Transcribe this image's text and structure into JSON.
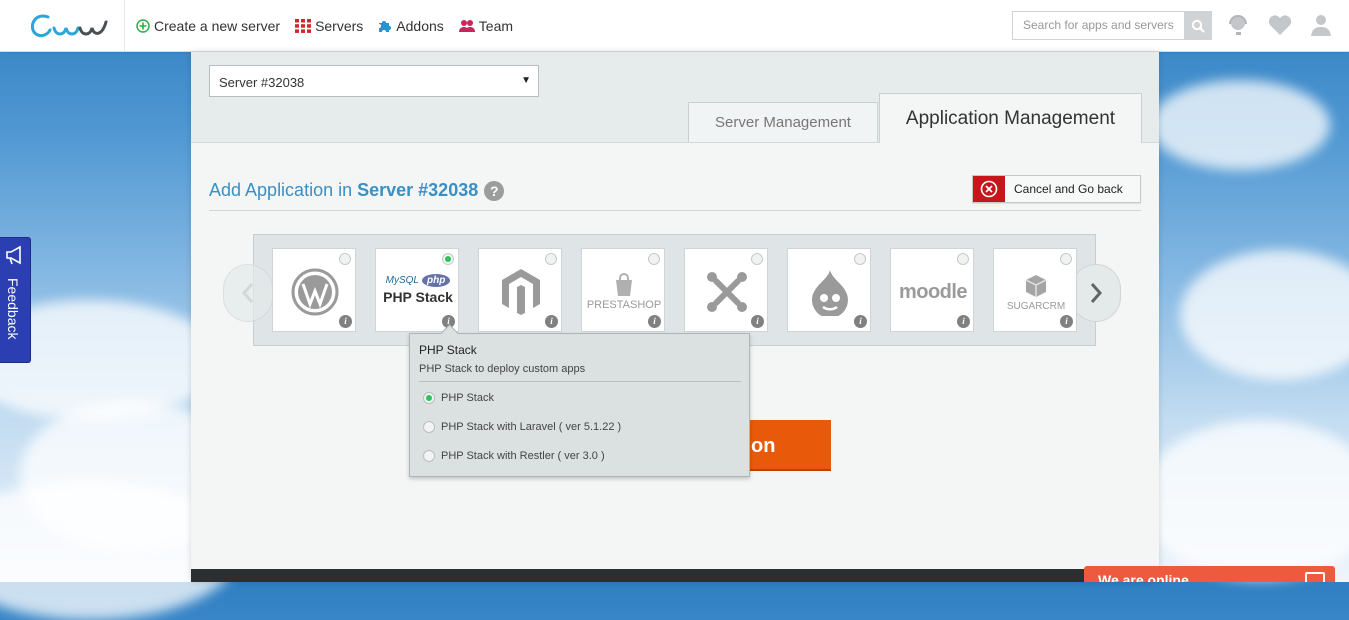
{
  "nav": {
    "create": "Create a new server",
    "servers": "Servers",
    "addons": "Addons",
    "team": "Team"
  },
  "search": {
    "placeholder": "Search for apps and servers"
  },
  "server_select": {
    "value": "Server #32038"
  },
  "tabs": {
    "server": "Server Management",
    "application": "Application Management"
  },
  "add_app": {
    "prefix": "Add Application in ",
    "server": "Server #32038",
    "help": "?"
  },
  "cancel": {
    "label": "Cancel and Go back"
  },
  "apps": {
    "php_mysql": "MySQL",
    "php_php": "php",
    "php_stack": "PHP Stack",
    "prestashop": "PRESTASHOP",
    "moodle": "moodle",
    "sugarcrm": "SUGARCRM",
    "info": "i"
  },
  "launch": {
    "label": "on"
  },
  "tooltip": {
    "title": "PHP Stack",
    "desc": "PHP Stack to deploy custom apps",
    "options": [
      "PHP Stack",
      "PHP Stack with Laravel ( ver 5.1.22 )",
      "PHP Stack with Restler ( ver 3.0 )"
    ]
  },
  "feedback": "Feedback",
  "chat": "We are online",
  "colors": {
    "accent": "#3a8fc3",
    "launch": "#e85a0a",
    "cancel_red": "#c6151b",
    "selected_green": "#2ec25b",
    "feedback": "#2b3fb2"
  }
}
